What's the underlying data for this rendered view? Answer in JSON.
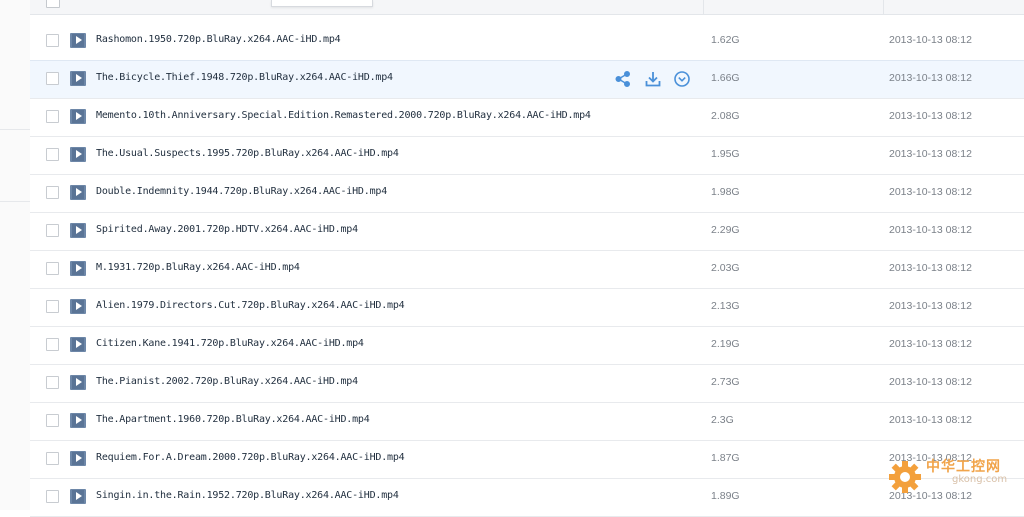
{
  "rows": [
    {
      "name": "Rashomon.1950.720p.BluRay.x264.AAC-iHD.mp4",
      "size": "1.62G",
      "date": "2013-10-13 08:12"
    },
    {
      "name": "The.Bicycle.Thief.1948.720p.BluRay.x264.AAC-iHD.mp4",
      "size": "1.66G",
      "date": "2013-10-13 08:12"
    },
    {
      "name": "Memento.10th.Anniversary.Special.Edition.Remastered.2000.720p.BluRay.x264.AAC-iHD.mp4",
      "size": "2.08G",
      "date": "2013-10-13 08:12"
    },
    {
      "name": "The.Usual.Suspects.1995.720p.BluRay.x264.AAC-iHD.mp4",
      "size": "1.95G",
      "date": "2013-10-13 08:12"
    },
    {
      "name": "Double.Indemnity.1944.720p.BluRay.x264.AAC-iHD.mp4",
      "size": "1.98G",
      "date": "2013-10-13 08:12"
    },
    {
      "name": "Spirited.Away.2001.720p.HDTV.x264.AAC-iHD.mp4",
      "size": "2.29G",
      "date": "2013-10-13 08:12"
    },
    {
      "name": "M.1931.720p.BluRay.x264.AAC-iHD.mp4",
      "size": "2.03G",
      "date": "2013-10-13 08:12"
    },
    {
      "name": "Alien.1979.Directors.Cut.720p.BluRay.x264.AAC-iHD.mp4",
      "size": "2.13G",
      "date": "2013-10-13 08:12"
    },
    {
      "name": "Citizen.Kane.1941.720p.BluRay.x264.AAC-iHD.mp4",
      "size": "2.19G",
      "date": "2013-10-13 08:12"
    },
    {
      "name": "The.Pianist.2002.720p.BluRay.x264.AAC-iHD.mp4",
      "size": "2.73G",
      "date": "2013-10-13 08:12"
    },
    {
      "name": "The.Apartment.1960.720p.BluRay.x264.AAC-iHD.mp4",
      "size": "2.3G",
      "date": "2013-10-13 08:12"
    },
    {
      "name": "Requiem.For.A.Dream.2000.720p.BluRay.x264.AAC-iHD.mp4",
      "size": "1.87G",
      "date": "2013-10-13 08:12"
    },
    {
      "name": "Singin.in.the.Rain.1952.720p.BluRay.x264.AAC-iHD.mp4",
      "size": "1.89G",
      "date": "2013-10-13 08:12"
    }
  ],
  "hover_row_index": 1,
  "row_actions": [
    "share-icon",
    "download-icon",
    "more-options-icon"
  ],
  "watermark": {
    "text_cn": "中华工控网",
    "text_en": "gkong.com"
  },
  "colors": {
    "accent": "#4a90d9",
    "hover_row": "#f1f7fe",
    "file_icon": "#5a7496"
  }
}
